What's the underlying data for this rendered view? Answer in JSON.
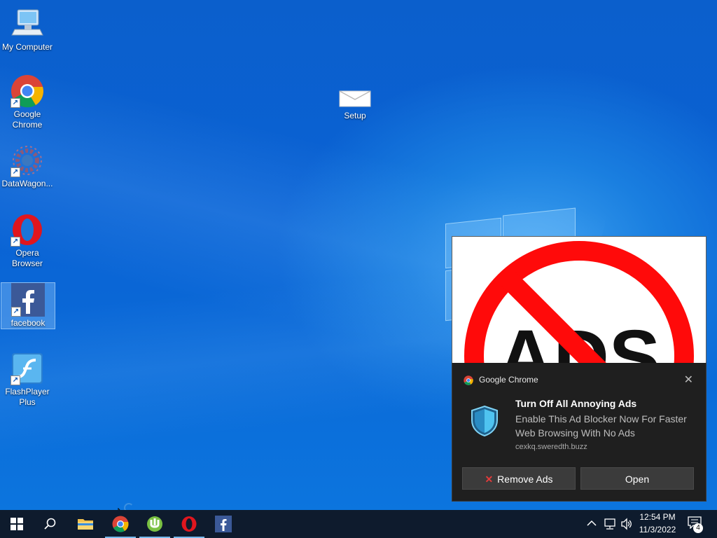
{
  "desktop": {
    "icons": [
      {
        "label": "My Computer"
      },
      {
        "label": "Google Chrome"
      },
      {
        "label": "DataWagon..."
      },
      {
        "label": "Opera Browser"
      },
      {
        "label": "facebook"
      },
      {
        "label": "FlashPlayer Plus"
      },
      {
        "label": "Setup"
      }
    ]
  },
  "ad_image": {
    "text": "ADS"
  },
  "notification": {
    "app_name": "Google Chrome",
    "close_glyph": "✕",
    "title": "Turn Off All Annoying Ads",
    "body": "Enable This Ad Blocker Now For Faster Web Browsing With No Ads",
    "source": "cexkq.sweredth.buzz",
    "buttons": {
      "remove": "Remove Ads",
      "open": "Open"
    }
  },
  "taskbar": {
    "pinned": [
      "start-icon",
      "search-icon",
      "file-explorer-icon",
      "chrome-icon",
      "utorrent-icon",
      "opera-icon",
      "facebook-icon"
    ],
    "clock": {
      "time": "12:54 PM",
      "date": "11/3/2022"
    },
    "notification_count": "4"
  }
}
